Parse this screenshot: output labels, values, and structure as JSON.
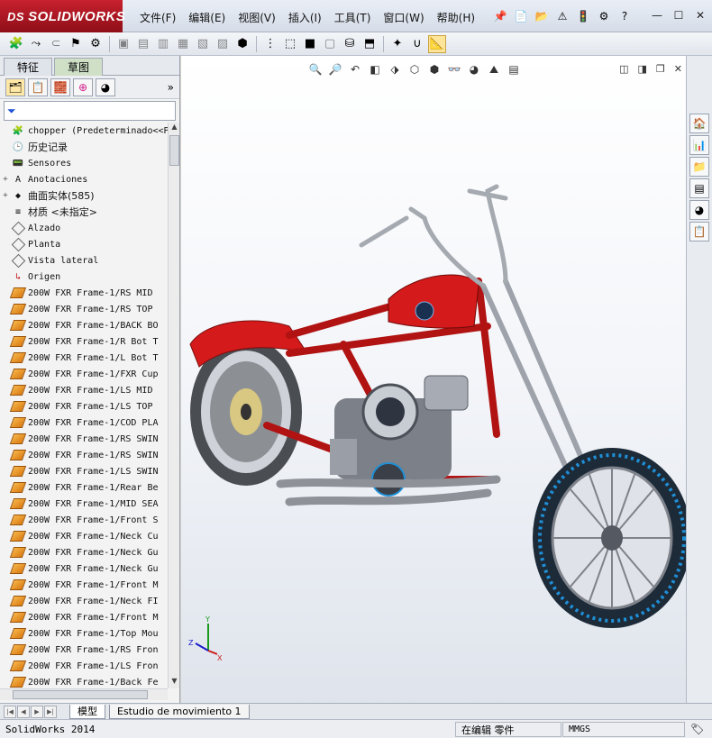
{
  "app": {
    "brand": "SOLIDWORKS",
    "brand_prefix": "DS"
  },
  "menu": [
    "文件(F)",
    "编辑(E)",
    "视图(V)",
    "插入(I)",
    "工具(T)",
    "窗口(W)",
    "帮助(H)"
  ],
  "left_panel": {
    "tabs": [
      "特征",
      "草图"
    ],
    "active_tab": 1,
    "more": "»",
    "filter_icon": "funnel-icon"
  },
  "tree": [
    {
      "label": "chopper  (Predeterminado<<Pr",
      "icon": "assembly-icon",
      "expand": ""
    },
    {
      "label": "历史记录",
      "icon": "history-icon",
      "expand": "",
      "cjk": true
    },
    {
      "label": "Sensores",
      "icon": "sensor-icon",
      "expand": ""
    },
    {
      "label": "Anotaciones",
      "icon": "annotation-icon",
      "expand": "+"
    },
    {
      "label": "曲面实体(585)",
      "icon": "surface-icon",
      "expand": "+",
      "cjk": true
    },
    {
      "label": "材质 <未指定>",
      "icon": "material-icon",
      "expand": "",
      "cjk": true
    },
    {
      "label": "Alzado",
      "icon": "plane-icon",
      "expand": ""
    },
    {
      "label": "Planta",
      "icon": "plane-icon",
      "expand": ""
    },
    {
      "label": "Vista lateral",
      "icon": "plane-icon",
      "expand": ""
    },
    {
      "label": "Origen",
      "icon": "origin-icon",
      "expand": ""
    },
    {
      "label": "200W FXR Frame-1/RS MID",
      "icon": "feature-icon",
      "expand": ""
    },
    {
      "label": "200W FXR Frame-1/RS TOP",
      "icon": "feature-icon",
      "expand": ""
    },
    {
      "label": "200W FXR Frame-1/BACK BO",
      "icon": "feature-icon",
      "expand": ""
    },
    {
      "label": "200W FXR Frame-1/R Bot T",
      "icon": "feature-icon",
      "expand": ""
    },
    {
      "label": "200W FXR Frame-1/L Bot T",
      "icon": "feature-icon",
      "expand": ""
    },
    {
      "label": "200W FXR Frame-1/FXR Cup",
      "icon": "feature-icon",
      "expand": ""
    },
    {
      "label": "200W FXR Frame-1/LS MID",
      "icon": "feature-icon",
      "expand": ""
    },
    {
      "label": "200W FXR Frame-1/LS TOP",
      "icon": "feature-icon",
      "expand": ""
    },
    {
      "label": "200W FXR Frame-1/COD PLA",
      "icon": "feature-icon",
      "expand": ""
    },
    {
      "label": "200W FXR Frame-1/RS SWIN",
      "icon": "feature-icon",
      "expand": ""
    },
    {
      "label": "200W FXR Frame-1/RS SWIN",
      "icon": "feature-icon",
      "expand": ""
    },
    {
      "label": "200W FXR Frame-1/LS SWIN",
      "icon": "feature-icon",
      "expand": ""
    },
    {
      "label": "200W FXR Frame-1/Rear Be",
      "icon": "feature-icon",
      "expand": ""
    },
    {
      "label": "200W FXR Frame-1/MID SEA",
      "icon": "feature-icon",
      "expand": ""
    },
    {
      "label": "200W FXR Frame-1/Front S",
      "icon": "feature-icon",
      "expand": ""
    },
    {
      "label": "200W FXR Frame-1/Neck Cu",
      "icon": "feature-icon",
      "expand": ""
    },
    {
      "label": "200W FXR Frame-1/Neck Gu",
      "icon": "feature-icon",
      "expand": ""
    },
    {
      "label": "200W FXR Frame-1/Neck Gu",
      "icon": "feature-icon",
      "expand": ""
    },
    {
      "label": "200W FXR Frame-1/Front M",
      "icon": "feature-icon",
      "expand": ""
    },
    {
      "label": "200W FXR Frame-1/Neck FI",
      "icon": "feature-icon",
      "expand": ""
    },
    {
      "label": "200W FXR Frame-1/Front M",
      "icon": "feature-icon",
      "expand": ""
    },
    {
      "label": "200W FXR Frame-1/Top Mou",
      "icon": "feature-icon",
      "expand": ""
    },
    {
      "label": "200W FXR Frame-1/RS Fron",
      "icon": "feature-icon",
      "expand": ""
    },
    {
      "label": "200W FXR Frame-1/LS Fron",
      "icon": "feature-icon",
      "expand": ""
    },
    {
      "label": "200W FXR Frame-1/Back Fe",
      "icon": "feature-icon",
      "expand": ""
    }
  ],
  "bottom_tabs": [
    "模型",
    "Estudio de movimiento 1"
  ],
  "status": {
    "app_version": "SolidWorks 2014",
    "mode": "在编辑 零件",
    "units": "MMGS"
  },
  "triad": {
    "x": "X",
    "y": "Y",
    "z": "Z"
  },
  "colors": {
    "frame_red": "#d41a1a",
    "tire_blue": "#1f8fd6",
    "chrome": "#b8bcc4",
    "brand_red": "#c8202e"
  }
}
